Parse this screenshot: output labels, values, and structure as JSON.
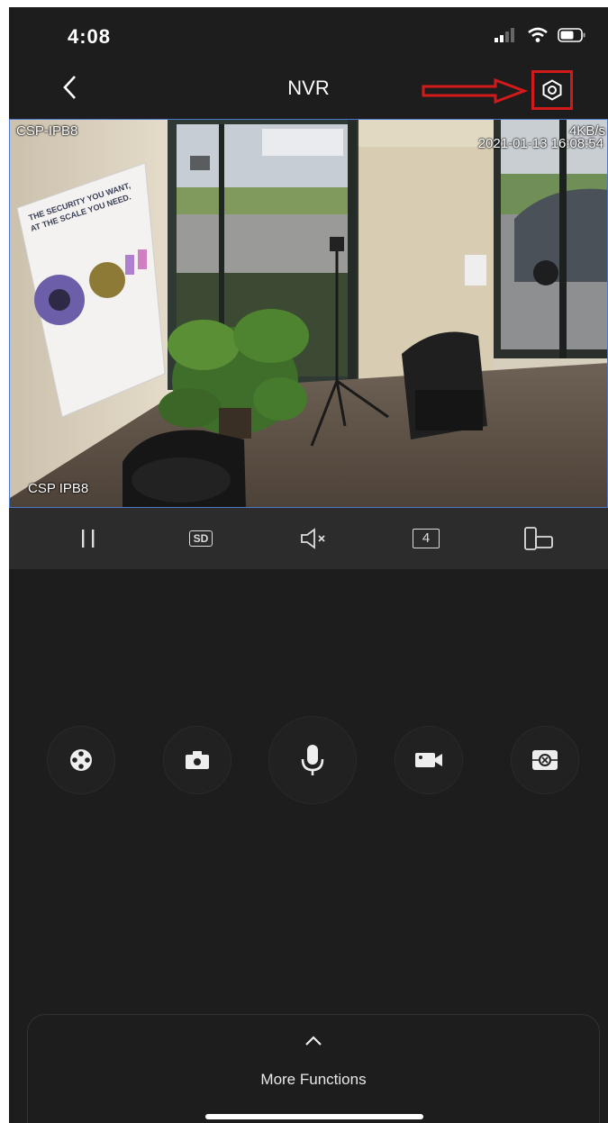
{
  "status_bar": {
    "time": "4:08"
  },
  "nav": {
    "title": "NVR"
  },
  "video": {
    "camera_name_top": "CSP-IPB8",
    "camera_name_bottom": "CSP IPB8",
    "bitrate": "4KB/s",
    "timestamp": "2021-01-13 16:08:54",
    "poster_line1": "THE SECURITY YOU WANT,",
    "poster_line2": "AT THE SCALE YOU NEED."
  },
  "toolbar": {
    "quality_label": "SD",
    "split_label": "4"
  },
  "more_functions": {
    "label": "More Functions"
  },
  "colors": {
    "background": "#1d1d1d",
    "toolbar": "#2c2c2c",
    "highlight": "#d21a1a",
    "video_border": "#4d78c9"
  }
}
